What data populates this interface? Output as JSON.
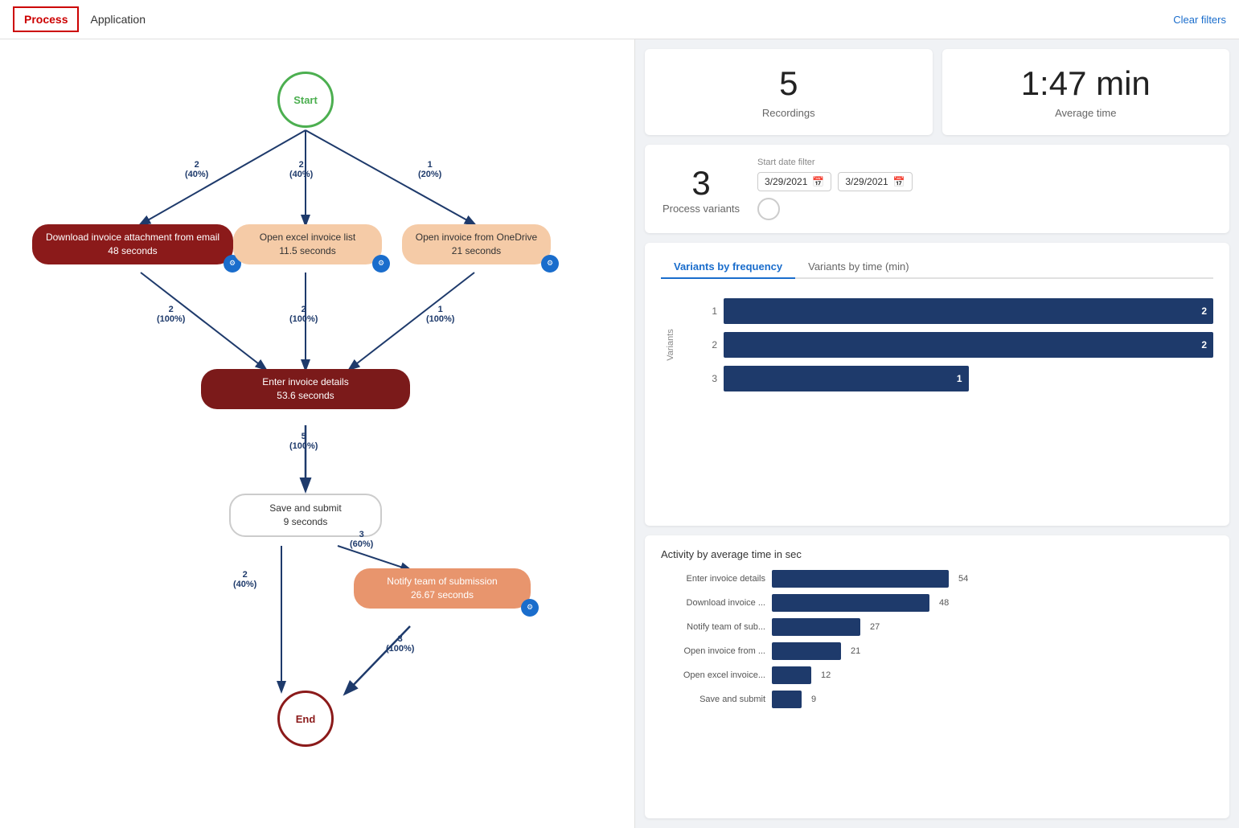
{
  "header": {
    "tab_process": "Process",
    "tab_application": "Application",
    "clear_filters": "Clear filters"
  },
  "stats": {
    "recordings_count": "5",
    "recordings_label": "Recordings",
    "avg_time": "1:47 min",
    "avg_time_label": "Average time",
    "variants_count": "3",
    "variants_label": "Process variants",
    "date_filter_label": "Start date filter",
    "date_from": "3/29/2021",
    "date_to": "3/29/2021"
  },
  "variants_chart": {
    "title_freq": "Variants by frequency",
    "title_time": "Variants by time (min)",
    "y_axis_label": "Variants",
    "bars": [
      {
        "label": "1",
        "value": 2,
        "width_pct": 100
      },
      {
        "label": "2",
        "value": 2,
        "width_pct": 100
      },
      {
        "label": "3",
        "value": 1,
        "width_pct": 50
      }
    ]
  },
  "activity_chart": {
    "title": "Activity by average time in sec",
    "bars": [
      {
        "label": "Enter invoice details",
        "value": 54,
        "width_pct": 100
      },
      {
        "label": "Download invoice ...",
        "value": 48,
        "width_pct": 89
      },
      {
        "label": "Notify team of sub...",
        "value": 27,
        "width_pct": 50
      },
      {
        "label": "Open invoice from ...",
        "value": 21,
        "width_pct": 39
      },
      {
        "label": "Open excel invoice...",
        "value": 12,
        "width_pct": 22
      },
      {
        "label": "Save and submit",
        "value": 9,
        "width_pct": 17
      }
    ]
  },
  "flow": {
    "start_label": "Start",
    "end_label": "End",
    "nodes": [
      {
        "id": "download",
        "label": "Download invoice attachment from email\n48 seconds",
        "type": "red-dark"
      },
      {
        "id": "open-excel",
        "label": "Open excel invoice list\n11.5 seconds",
        "type": "peach"
      },
      {
        "id": "open-onedrive",
        "label": "Open invoice from OneDrive\n21 seconds",
        "type": "peach"
      },
      {
        "id": "enter-details",
        "label": "Enter invoice details\n53.6 seconds",
        "type": "dark-red"
      },
      {
        "id": "save-submit",
        "label": "Save and submit\n9 seconds",
        "type": "white-border"
      },
      {
        "id": "notify",
        "label": "Notify team of submission\n26.67 seconds",
        "type": "peach-dark"
      }
    ],
    "edges": [
      {
        "from": "start",
        "to": "download",
        "count": "2",
        "pct": "(40%)"
      },
      {
        "from": "start",
        "to": "open-excel",
        "count": "2",
        "pct": "(40%)"
      },
      {
        "from": "start",
        "to": "open-onedrive",
        "count": "1",
        "pct": "(20%)"
      },
      {
        "from": "download",
        "to": "enter-details",
        "count": "2",
        "pct": "(100%)"
      },
      {
        "from": "open-excel",
        "to": "enter-details",
        "count": "2",
        "pct": "(100%)"
      },
      {
        "from": "open-onedrive",
        "to": "enter-details",
        "count": "1",
        "pct": "(100%)"
      },
      {
        "from": "enter-details",
        "to": "save-submit",
        "count": "5",
        "pct": "(100%)"
      },
      {
        "from": "save-submit",
        "to": "notify",
        "count": "3",
        "pct": "(60%)"
      },
      {
        "from": "save-submit",
        "to": "end",
        "count": "2",
        "pct": "(40%)"
      },
      {
        "from": "notify",
        "to": "end",
        "count": "3",
        "pct": "(100%)"
      }
    ]
  }
}
